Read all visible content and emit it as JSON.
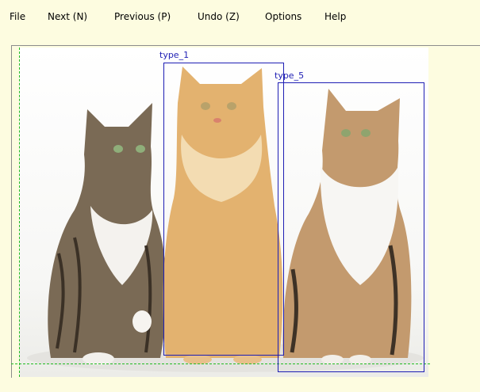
{
  "menu": {
    "file": "File",
    "next": "Next (N)",
    "previous": "Previous (P)",
    "undo": "Undo (Z)",
    "options": "Options",
    "help": "Help"
  },
  "image": {
    "description_icon": "photo-cats"
  },
  "annotations": [
    {
      "label": "type_1"
    },
    {
      "label": "type_5"
    }
  ],
  "colors": {
    "background": "#fdfce0",
    "bbox": "#1e1eb4",
    "guide": "#22bb22"
  }
}
